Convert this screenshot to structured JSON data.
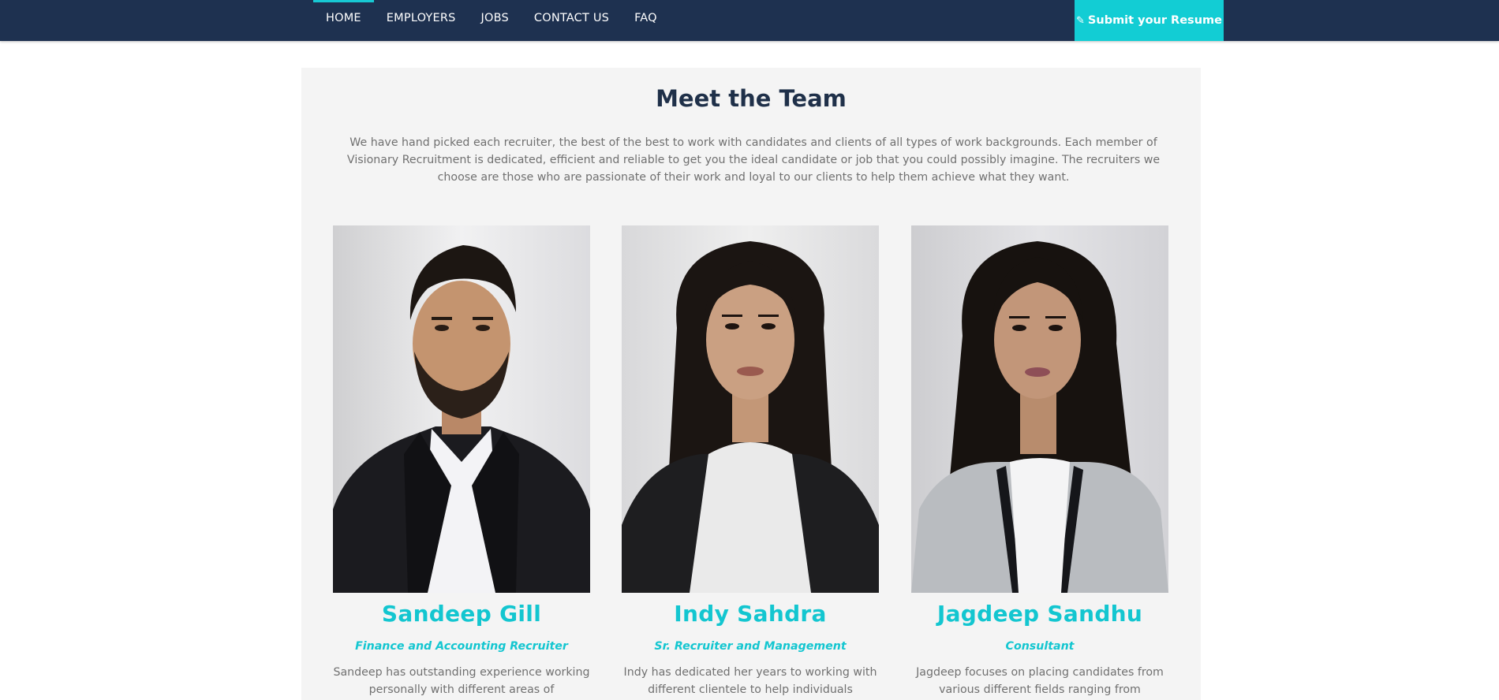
{
  "nav": {
    "items": [
      {
        "label": "HOME",
        "active": true
      },
      {
        "label": "EMPLOYERS",
        "active": false
      },
      {
        "label": "JOBS",
        "active": false
      },
      {
        "label": "CONTACT US",
        "active": false
      },
      {
        "label": "FAQ",
        "active": false
      }
    ],
    "cta_label": "Submit your Resume",
    "cta_icon": "pencil-icon"
  },
  "section": {
    "title": "Meet the Team",
    "intro": "We have hand picked each recruiter, the best of the best to work with candidates and clients of all types of work backgrounds. Each member of Visionary Recruitment is dedicated, efficient and reliable to get you the ideal candidate or job that you could possibly imagine. The recruiters we choose are those who are passionate of their work and loyal to our clients to help them achieve what they want."
  },
  "team": [
    {
      "name": "Sandeep Gill",
      "role": "Finance and Accounting Recruiter",
      "bio": "Sandeep has outstanding experience working personally with different areas of"
    },
    {
      "name": "Indy Sahdra",
      "role": "Sr. Recruiter and Management",
      "bio": "Indy has dedicated her years to working with different clientele to help individuals"
    },
    {
      "name": "Jagdeep Sandhu",
      "role": "Consultant",
      "bio": "Jagdeep focuses on placing candidates from various different fields ranging from"
    }
  ],
  "colors": {
    "navbar": "#1e3150",
    "accent": "#12cdd4",
    "title": "#1f3049",
    "text": "#707070",
    "panel": "#f4f4f4"
  }
}
